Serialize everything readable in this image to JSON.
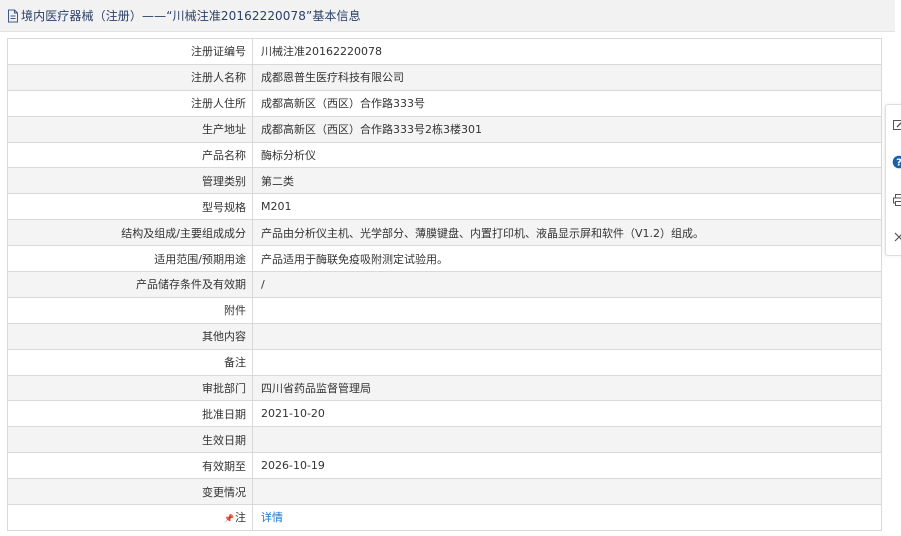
{
  "header": {
    "icon": "document-icon",
    "title": "境内医疗器械（注册）——“川械注准20162220078”基本信息"
  },
  "rows": [
    {
      "label": "注册证编号",
      "value": "川械注准20162220078"
    },
    {
      "label": "注册人名称",
      "value": "成都恩普生医疗科技有限公司"
    },
    {
      "label": "注册人住所",
      "value": "成都高新区（西区）合作路333号"
    },
    {
      "label": "生产地址",
      "value": "成都高新区（西区）合作路333号2栋3楼301"
    },
    {
      "label": "产品名称",
      "value": "酶标分析仪"
    },
    {
      "label": "管理类别",
      "value": "第二类"
    },
    {
      "label": "型号规格",
      "value": "M201"
    },
    {
      "label": "结构及组成/主要组成成分",
      "value": "产品由分析仪主机、光学部分、薄膜键盘、内置打印机、液晶显示屏和软件（V1.2）组成。"
    },
    {
      "label": "适用范围/预期用途",
      "value": "产品适用于酶联免疫吸附测定试验用。"
    },
    {
      "label": "产品储存条件及有效期",
      "value": "/"
    },
    {
      "label": "附件",
      "value": ""
    },
    {
      "label": "其他内容",
      "value": ""
    },
    {
      "label": "备注",
      "value": ""
    },
    {
      "label": "审批部门",
      "value": "四川省药品监督管理局"
    },
    {
      "label": "批准日期",
      "value": "2021-10-20"
    },
    {
      "label": "生效日期",
      "value": ""
    },
    {
      "label": "有效期至",
      "value": "2026-10-19"
    },
    {
      "label": "变更情况",
      "value": ""
    }
  ],
  "note": {
    "label": "注",
    "link": "详情",
    "icon": "pin-icon"
  },
  "side_toolbar": {
    "icons": [
      "edit-icon",
      "help-icon",
      "print-icon",
      "close-icon"
    ]
  },
  "colors": {
    "title": "#2a3f66",
    "link": "#1a73c8",
    "help": "#1f5fa8"
  }
}
